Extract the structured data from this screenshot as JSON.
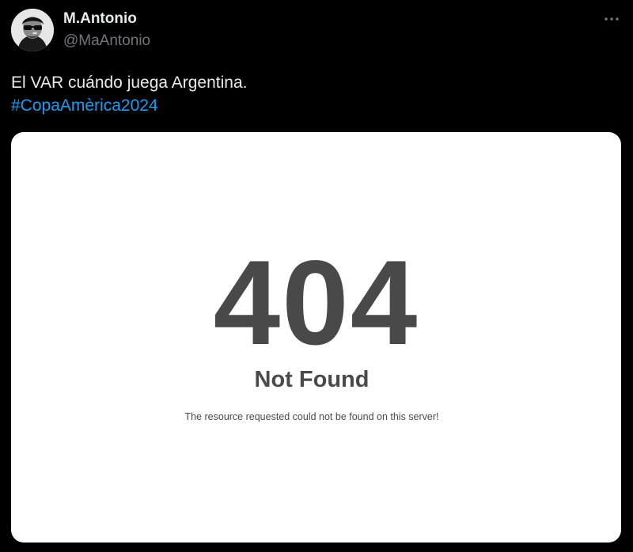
{
  "author": {
    "display_name": "M.Antonio",
    "handle": "@MaAntonio",
    "avatar_icon": "profile-photo"
  },
  "menu": {
    "more_icon": "more-horizontal-icon"
  },
  "tweet": {
    "text": "El VAR cuándo juega Argentina.",
    "hashtag": "#CopaAmèrica2024"
  },
  "media": {
    "error_code": "404",
    "error_title": "Not Found",
    "error_message": "The resource requested could not be found on this server!"
  },
  "colors": {
    "background": "#000000",
    "text_primary": "#e7e9ea",
    "text_secondary": "#71767b",
    "link": "#1d9bf0",
    "card_background": "#ffffff",
    "error_text": "#494949"
  }
}
